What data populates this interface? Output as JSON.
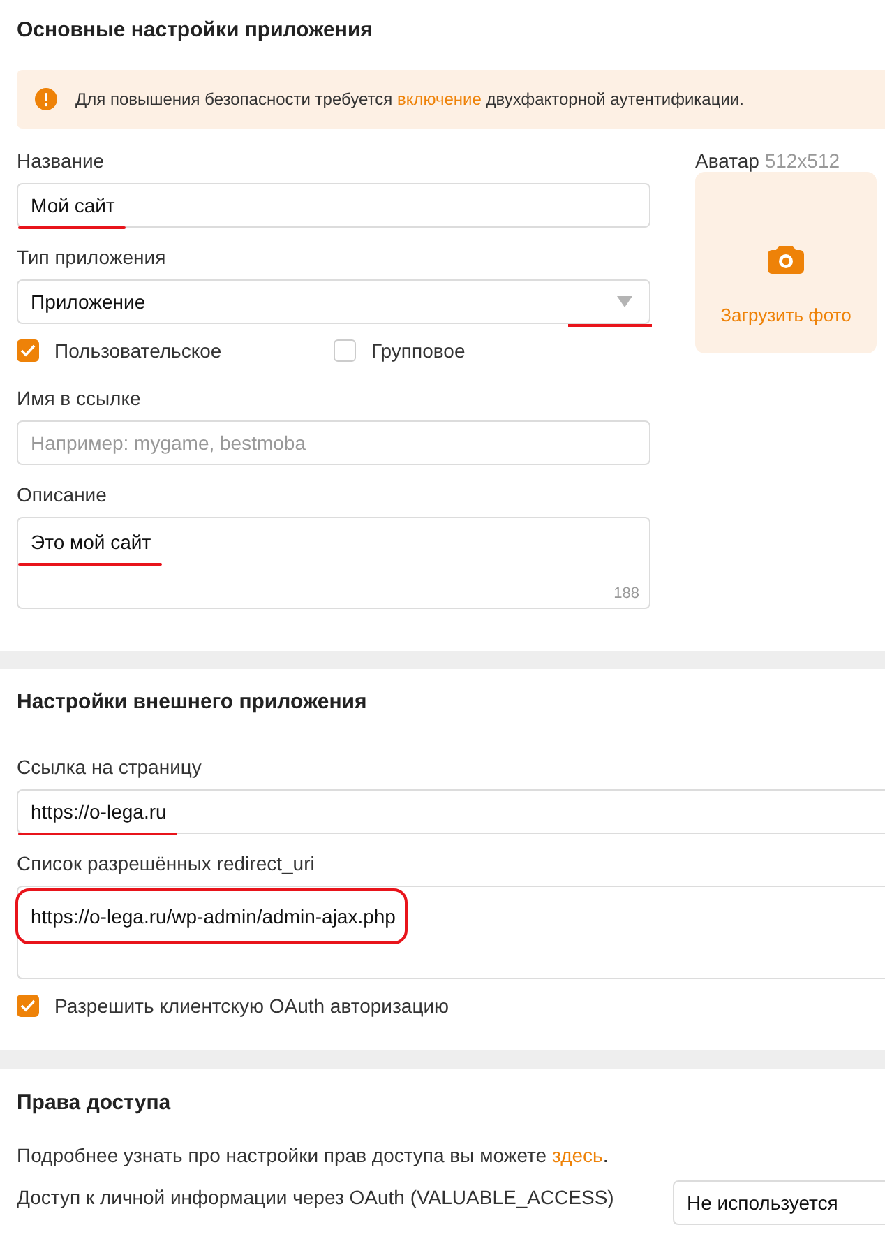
{
  "main_settings": {
    "title": "Основные настройки приложения",
    "alert": {
      "text_before": "Для повышения безопасности требуется ",
      "link": "включение",
      "text_after": " двухфакторной аутентификации."
    },
    "name_field": {
      "label": "Название",
      "value": "Мой сайт",
      "underlined": true
    },
    "type_select": {
      "label": "Тип приложения",
      "value": "Приложение",
      "underlined": true
    },
    "type_options": [
      {
        "label": "Пользовательское",
        "checked": true
      },
      {
        "label": "Групповое",
        "checked": false
      }
    ],
    "slug_field": {
      "label": "Имя в ссылке",
      "placeholder": "Например: mygame, bestmoba"
    },
    "description_field": {
      "label": "Описание",
      "value": "Это мой сайт",
      "counter": "188",
      "underlined": true
    },
    "avatar": {
      "label": "Аватар",
      "size_hint": "512x512",
      "upload_label": "Загрузить фото"
    }
  },
  "external_settings": {
    "title": "Настройки внешнего приложения",
    "page_url_field": {
      "label": "Ссылка на страницу",
      "value": "https://o-lega.ru",
      "underlined": true
    },
    "redirect_uris_field": {
      "label": "Список разрешённых redirect_uri",
      "value": "https://o-lega.ru/wp-admin/admin-ajax.php",
      "circled": true
    },
    "oauth_checkbox": {
      "label": "Разрешить клиентскую OAuth авторизацию",
      "checked": true
    }
  },
  "access_rights": {
    "title": "Права доступа",
    "info": {
      "text_before": "Подробнее узнать про настройки прав доступа вы можете ",
      "link": "здесь",
      "text_after": "."
    },
    "valuable_access": {
      "label": "Доступ к личной информации через OAuth (VALUABLE_ACCESS)",
      "value": "Не используется"
    }
  }
}
